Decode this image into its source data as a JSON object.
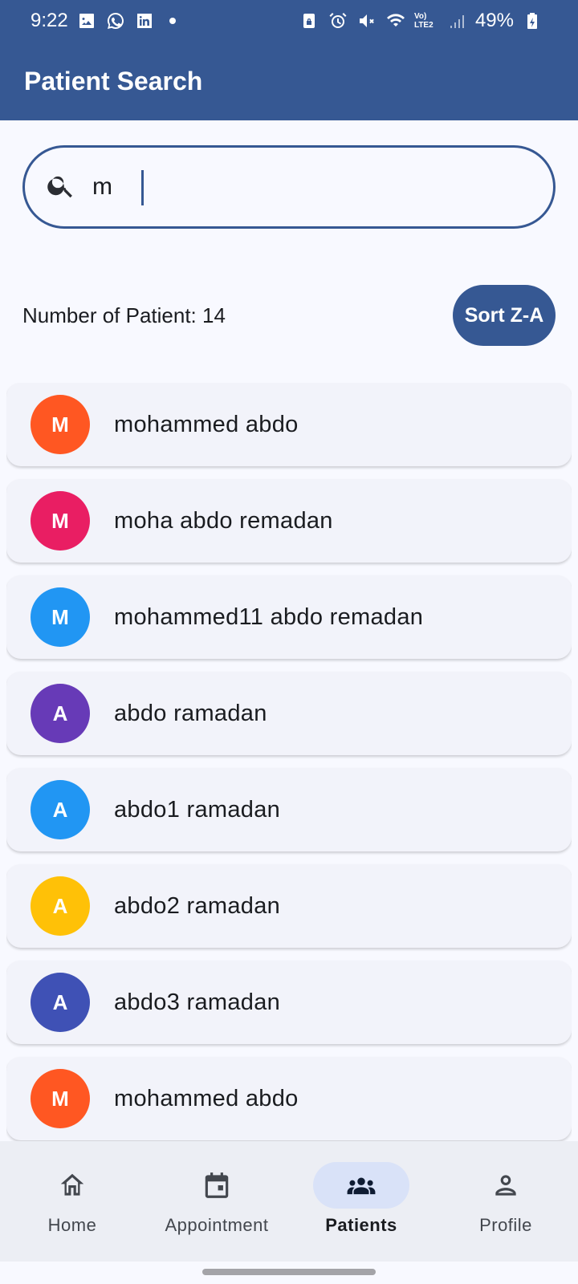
{
  "status_bar": {
    "time": "9:22",
    "battery": "49%",
    "network_label": "Vo) LTE2",
    "left_icons": [
      "gallery-icon",
      "whatsapp-icon",
      "linkedin-icon"
    ],
    "right_icons": [
      "lock-icon",
      "alarm-icon",
      "mute-icon",
      "wifi-icon",
      "signal-icon",
      "battery-icon"
    ]
  },
  "app_bar": {
    "title": "Patient Search"
  },
  "search": {
    "value": "m",
    "placeholder": ""
  },
  "summary": {
    "count_text": "Number of Patient: 14",
    "sort_label": "Sort Z-A"
  },
  "patients": [
    {
      "initial": "M",
      "name": "mohammed abdo",
      "color": "#ff5722"
    },
    {
      "initial": "M",
      "name": "moha abdo remadan",
      "color": "#e91e63"
    },
    {
      "initial": "M",
      "name": "mohammed11 abdo remadan",
      "color": "#2196f3"
    },
    {
      "initial": "A",
      "name": "abdo ramadan",
      "color": "#673ab7"
    },
    {
      "initial": "A",
      "name": "abdo1 ramadan",
      "color": "#2196f3"
    },
    {
      "initial": "A",
      "name": "abdo2 ramadan",
      "color": "#ffc107"
    },
    {
      "initial": "A",
      "name": "abdo3 ramadan",
      "color": "#3f51b5"
    },
    {
      "initial": "M",
      "name": "mohammed abdo",
      "color": "#ff5722"
    }
  ],
  "nav": [
    {
      "label": "Home",
      "icon": "home-icon",
      "active": false
    },
    {
      "label": "Appointment",
      "icon": "calendar-icon",
      "active": false
    },
    {
      "label": "Patients",
      "icon": "people-icon",
      "active": true
    },
    {
      "label": "Profile",
      "icon": "person-icon",
      "active": false
    }
  ],
  "colors": {
    "primary": "#365893",
    "background": "#f8f9ff",
    "card": "#f2f3fa",
    "nav_indicator": "#d9e2f8"
  }
}
